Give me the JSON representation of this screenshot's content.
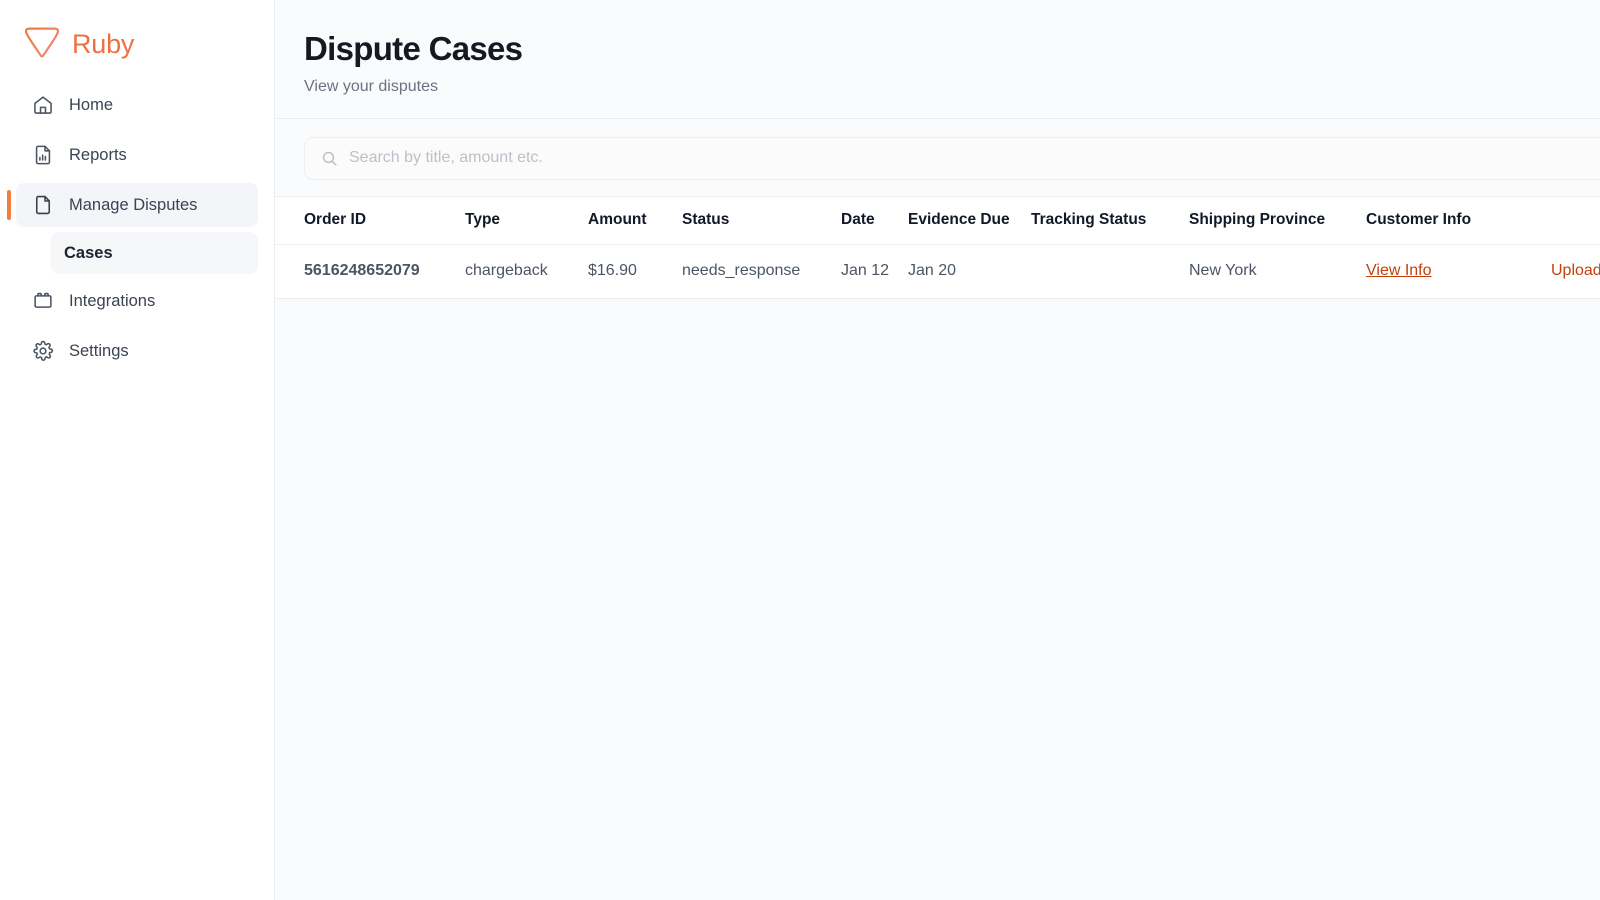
{
  "brand": {
    "name": "Ruby",
    "logo_icon": "gem-icon",
    "color": "#ef7044"
  },
  "sidebar": {
    "items": [
      {
        "label": "Home",
        "icon": "home-icon",
        "active": false
      },
      {
        "label": "Reports",
        "icon": "report-document-icon",
        "active": false
      },
      {
        "label": "Manage Disputes",
        "icon": "file-icon",
        "active": true
      }
    ],
    "sub_items": [
      {
        "label": "Cases",
        "parent": "Manage Disputes",
        "active": true
      }
    ],
    "integrations": {
      "label": "Integrations",
      "icon": "puzzle-brick-icon"
    },
    "settings": {
      "label": "Settings",
      "icon": "gear-icon"
    },
    "active_indicator_color": "#f0803c"
  },
  "header": {
    "title": "Dispute Cases",
    "subtitle": "View your disputes"
  },
  "search": {
    "placeholder": "Search by title, amount etc.",
    "value": "",
    "icon": "search-icon"
  },
  "table": {
    "columns": [
      "Order ID",
      "Type",
      "Amount",
      "Status",
      "Date",
      "Evidence Due",
      "Tracking Status",
      "Shipping Province",
      "Customer Info",
      ""
    ],
    "rows": [
      {
        "order_id": "5616248652079",
        "type": "chargeback",
        "amount": "$16.90",
        "status": "needs_response",
        "date": "Jan 12",
        "evidence_due": "Jan 20",
        "tracking_status": "",
        "shipping_province": "New York",
        "customer_info": "View Info",
        "action": "Upload Evidence"
      }
    ]
  },
  "colors": {
    "accent": "#ef7044",
    "link": "#c2410c",
    "page_bg": "#fafbfd",
    "sidebar_bg": "#ffffff",
    "border": "#ebedf1"
  }
}
